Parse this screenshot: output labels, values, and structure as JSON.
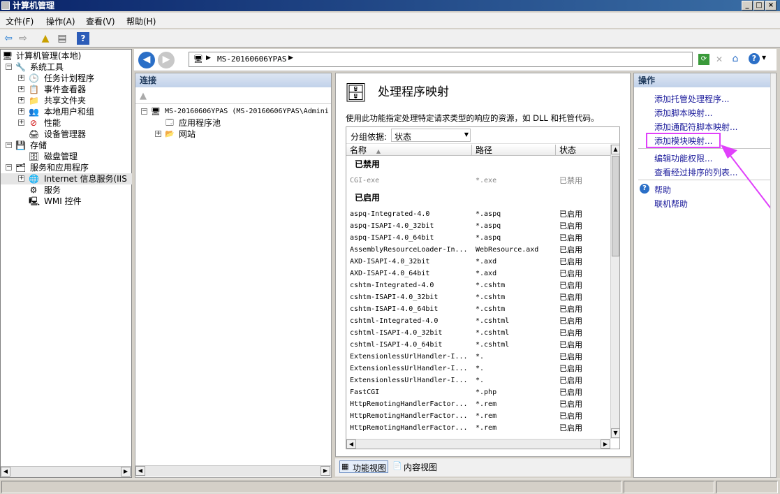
{
  "window": {
    "title": "计算机管理"
  },
  "menu": [
    "文件(F)",
    "操作(A)",
    "查看(V)",
    "帮助(H)"
  ],
  "tree": {
    "root": "计算机管理(本地)",
    "system_tools": "系统工具",
    "task_scheduler": "任务计划程序",
    "event_viewer": "事件查看器",
    "shared_folders": "共享文件夹",
    "local_users": "本地用户和组",
    "performance": "性能",
    "device_manager": "设备管理器",
    "storage": "存储",
    "disk_management": "磁盘管理",
    "services_apps": "服务和应用程序",
    "iis": "Internet 信息服务(IIS",
    "services": "服务",
    "wmi": "WMI 控件"
  },
  "address": {
    "path": "MS-20160606YPAS"
  },
  "connections": {
    "header": "连接",
    "server": "MS-20160606YPAS (MS-20160606YPAS\\Admini",
    "app_pools": "应用程序池",
    "sites": "网站"
  },
  "center": {
    "title": "处理程序映射",
    "description": "使用此功能指定处理特定请求类型的响应的资源，如 DLL 和托管代码。",
    "group_by_label": "分组依据:",
    "group_by_value": "状态",
    "columns": [
      "名称",
      "路径",
      "状态"
    ],
    "group_disabled": "已禁用",
    "group_enabled": "已启用",
    "disabled_rows": [
      {
        "name": "CGI-exe",
        "path": "*.exe",
        "state": "已禁用"
      }
    ],
    "enabled_rows": [
      {
        "name": "aspq-Integrated-4.0",
        "path": "*.aspq",
        "state": "已启用"
      },
      {
        "name": "aspq-ISAPI-4.0_32bit",
        "path": "*.aspq",
        "state": "已启用"
      },
      {
        "name": "aspq-ISAPI-4.0_64bit",
        "path": "*.aspq",
        "state": "已启用"
      },
      {
        "name": "AssemblyResourceLoader-In...",
        "path": "WebResource.axd",
        "state": "已启用"
      },
      {
        "name": "AXD-ISAPI-4.0_32bit",
        "path": "*.axd",
        "state": "已启用"
      },
      {
        "name": "AXD-ISAPI-4.0_64bit",
        "path": "*.axd",
        "state": "已启用"
      },
      {
        "name": "cshtm-Integrated-4.0",
        "path": "*.cshtm",
        "state": "已启用"
      },
      {
        "name": "cshtm-ISAPI-4.0_32bit",
        "path": "*.cshtm",
        "state": "已启用"
      },
      {
        "name": "cshtm-ISAPI-4.0_64bit",
        "path": "*.cshtm",
        "state": "已启用"
      },
      {
        "name": "cshtml-Integrated-4.0",
        "path": "*.cshtml",
        "state": "已启用"
      },
      {
        "name": "cshtml-ISAPI-4.0_32bit",
        "path": "*.cshtml",
        "state": "已启用"
      },
      {
        "name": "cshtml-ISAPI-4.0_64bit",
        "path": "*.cshtml",
        "state": "已启用"
      },
      {
        "name": "ExtensionlessUrlHandler-I...",
        "path": "*.",
        "state": "已启用"
      },
      {
        "name": "ExtensionlessUrlHandler-I...",
        "path": "*.",
        "state": "已启用"
      },
      {
        "name": "ExtensionlessUrlHandler-I...",
        "path": "*.",
        "state": "已启用"
      },
      {
        "name": "FastCGI",
        "path": "*.php",
        "state": "已启用"
      },
      {
        "name": "HttpRemotingHandlerFactor...",
        "path": "*.rem",
        "state": "已启用"
      },
      {
        "name": "HttpRemotingHandlerFactor...",
        "path": "*.rem",
        "state": "已启用"
      },
      {
        "name": "HttpRemotingHandlerFactor...",
        "path": "*.rem",
        "state": "已启用"
      }
    ],
    "tab_features": "功能视图",
    "tab_content": "内容视图"
  },
  "actions": {
    "header": "操作",
    "add_managed": "添加托管处理程序...",
    "add_script": "添加脚本映射...",
    "add_wildcard": "添加通配符脚本映射...",
    "add_module": "添加模块映射...",
    "edit_permissions": "编辑功能权限...",
    "view_ordered": "查看经过排序的列表...",
    "help": "帮助",
    "online_help": "联机帮助"
  },
  "colors": {
    "highlight_box": "#e040fb",
    "arrow": "#e040fb",
    "link": "#1c1c9c"
  }
}
